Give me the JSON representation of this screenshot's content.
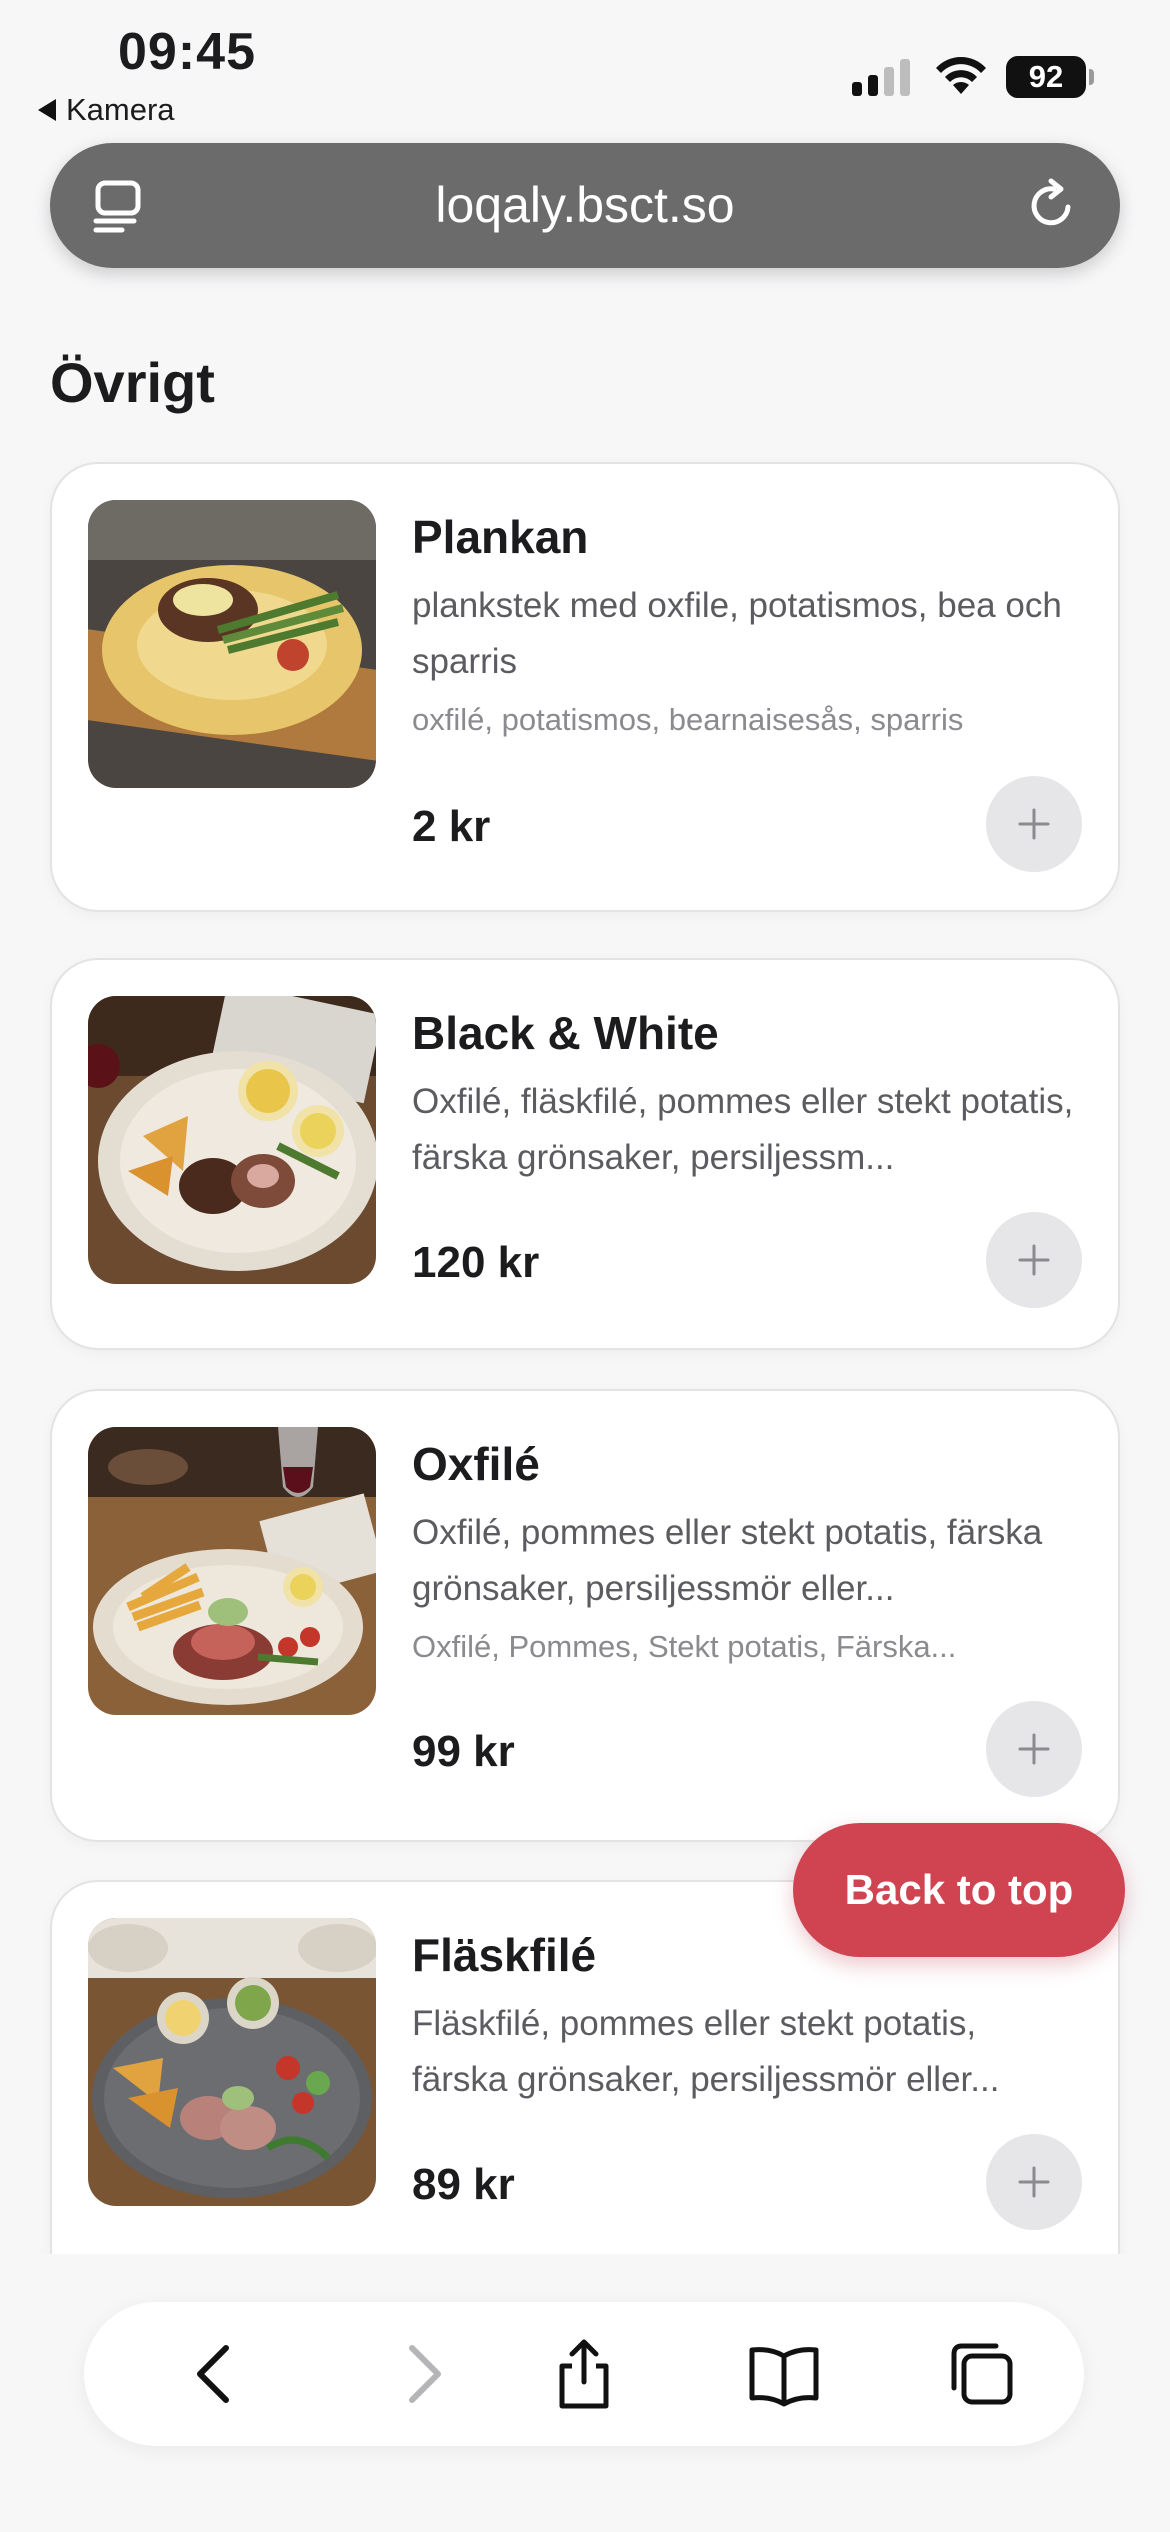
{
  "status_bar": {
    "time": "09:45",
    "back_app": "Kamera",
    "battery": "92"
  },
  "url_bar": {
    "url": "loqaly.bsct.so"
  },
  "section": {
    "title": "Övrigt"
  },
  "items": [
    {
      "name": "Plankan",
      "description": "plankstek med oxfile, potatismos, bea och sparris",
      "tags": "oxfilé, potatismos, bearnaisesås, sparris",
      "price": "2 kr"
    },
    {
      "name": "Black & White",
      "description": "Oxfilé, fläskfilé, pommes eller stekt potatis, färska grönsaker, persiljessm...",
      "tags": "",
      "price": "120 kr"
    },
    {
      "name": "Oxfilé",
      "description": "Oxfilé, pommes eller stekt potatis, färska grönsaker, persiljessmör eller...",
      "tags": "Oxfilé, Pommes, Stekt potatis, Färska...",
      "price": "99 kr"
    },
    {
      "name": "Fläskfilé",
      "description": "Fläskfilé, pommes eller stekt potatis, färska grönsaker, persiljessmör eller...",
      "tags": "",
      "price": "89 kr"
    }
  ],
  "back_to_top": {
    "label": "Back to top"
  },
  "colors": {
    "accent": "#cf4450",
    "url_bar": "#6b6b6b",
    "text": "#1c1c1e",
    "muted": "#5b5b60"
  },
  "icons": {
    "reader": "reader-icon",
    "reload": "reload-icon",
    "add": "plus-icon",
    "back": "chevron-left-icon",
    "forward": "chevron-right-icon",
    "share": "share-icon",
    "bookmarks": "book-icon",
    "tabs": "tabs-icon"
  }
}
